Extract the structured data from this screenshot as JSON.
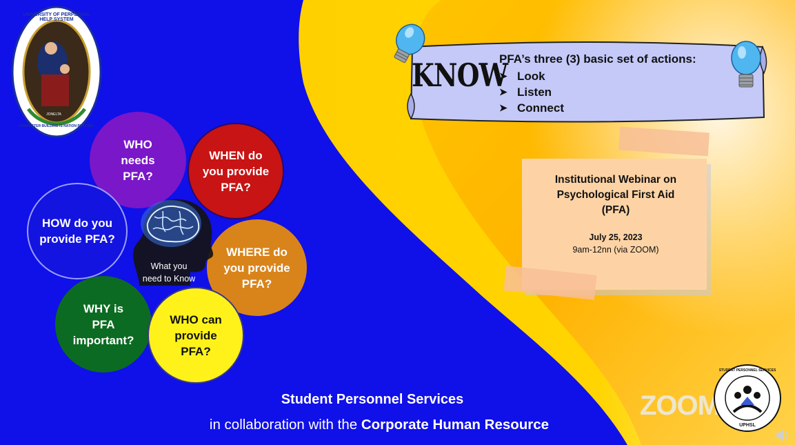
{
  "logo": {
    "ring_text": "UNIVERSITY OF PERPETUAL HELP SYSTEM",
    "motto": "CHARACTER BUILDING IS NATION BUILDING",
    "small_text": "JONELTA"
  },
  "know": {
    "word": "KNOW",
    "title": "PFA’s three (3) basic set of actions:",
    "actions": [
      "Look",
      "Listen",
      "Connect"
    ],
    "arrow": "➤"
  },
  "bubbles": {
    "who_needs": "WHO\nneeds\nPFA?",
    "when": "WHEN do\nyou provide\nPFA?",
    "how": "HOW do you\nprovide PFA?",
    "where": "WHERE do\nyou provide\nPFA?",
    "why": "WHY is\nPFA\nimportant?",
    "who_can": "WHO can\nprovide\nPFA?",
    "center": "What you\nneed to Know"
  },
  "webinar": {
    "title": "Institutional Webinar on\nPsychological First Aid\n(PFA)",
    "date": "July 25, 2023",
    "time": "9am-12nn (via ZOOM)"
  },
  "footer": {
    "line1": "Student Personnel Services",
    "line2_prefix": "in collaboration with the ",
    "line2_bold": "Corporate Human Resource"
  },
  "sps_logo": {
    "ring_text": "STUDENT PERSONNEL SERVICES",
    "bottom_text": "UPHSL"
  },
  "watermark": "ZOOM",
  "colors": {
    "blue_bg": "#1010e8",
    "yellow": "#ffd400",
    "purple": "#7a17c9",
    "red": "#c81414",
    "orange": "#d9841a",
    "green": "#0c6b22",
    "bright_yellow": "#fff21a",
    "note": "#fdd3a5"
  }
}
